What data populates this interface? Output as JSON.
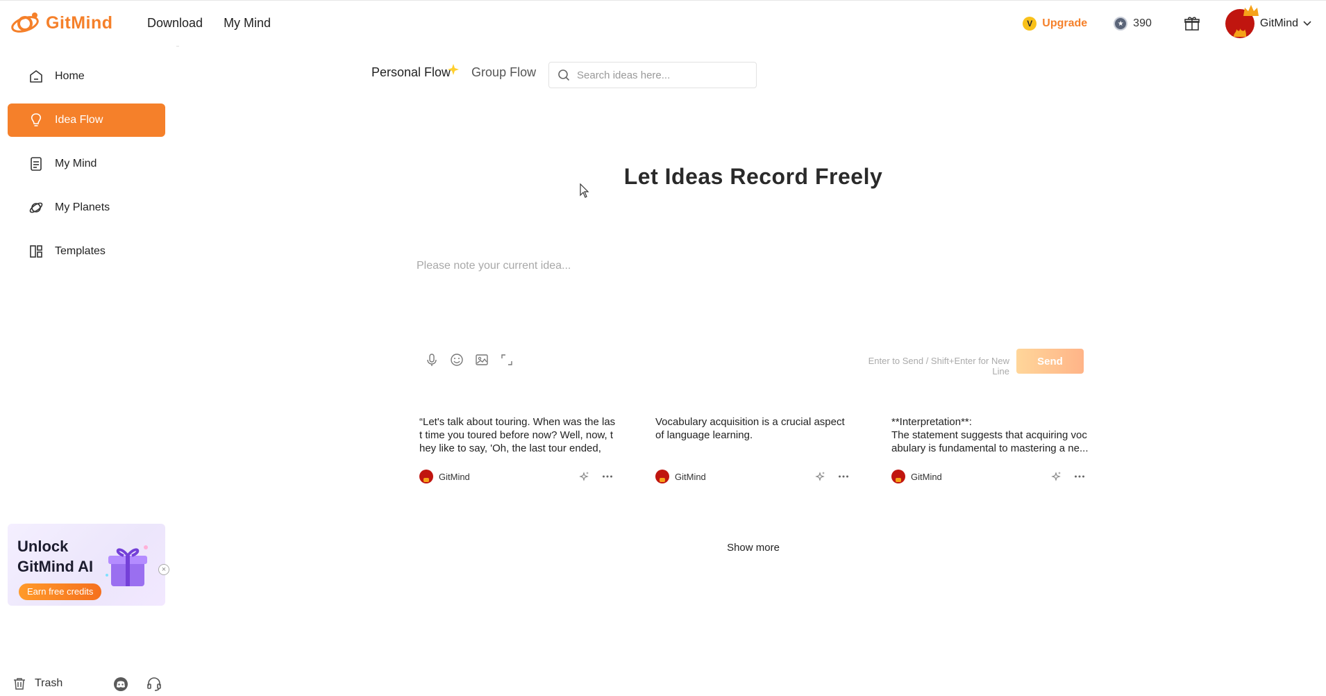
{
  "brand": {
    "name": "GitMind",
    "color": "#f5802a"
  },
  "topnav": {
    "download": "Download",
    "my_mind": "My Mind"
  },
  "account": {
    "upgrade": "Upgrade",
    "upgrade_badge": "V",
    "credits": "390",
    "user_name": "GitMind"
  },
  "sidebar": {
    "items": [
      {
        "label": "Home",
        "icon": "home-icon"
      },
      {
        "label": "Idea Flow",
        "icon": "lightbulb-icon",
        "active": true
      },
      {
        "label": "My Mind",
        "icon": "document-icon"
      },
      {
        "label": "My Planets",
        "icon": "planet-icon"
      },
      {
        "label": "Templates",
        "icon": "templates-icon"
      }
    ],
    "promo": {
      "title_line1": "Unlock",
      "title_line2": "GitMind AI",
      "button": "Earn free credits"
    },
    "trash": "Trash"
  },
  "flow": {
    "tabs": [
      "Personal Flow",
      "Group Flow"
    ],
    "search_placeholder": "Search ideas here...",
    "headline": "Let Ideas Record Freely",
    "input_placeholder": "Please note your current idea...",
    "send_hint": "Enter to Send / Shift+Enter for New Line",
    "send_label": "Send",
    "show_more": "Show more"
  },
  "cards": [
    {
      "text": "“Let's talk about touring. When was the last time you toured before now? Well, now, they like to say, 'Oh, the last tour ended, a...",
      "author": "GitMind"
    },
    {
      "text": "Vocabulary acquisition is a crucial aspect of language learning.",
      "author": "GitMind"
    },
    {
      "text": "**Interpretation**:\nThe statement suggests that acquiring vocabulary is fundamental to mastering a ne...",
      "author": "GitMind"
    }
  ]
}
